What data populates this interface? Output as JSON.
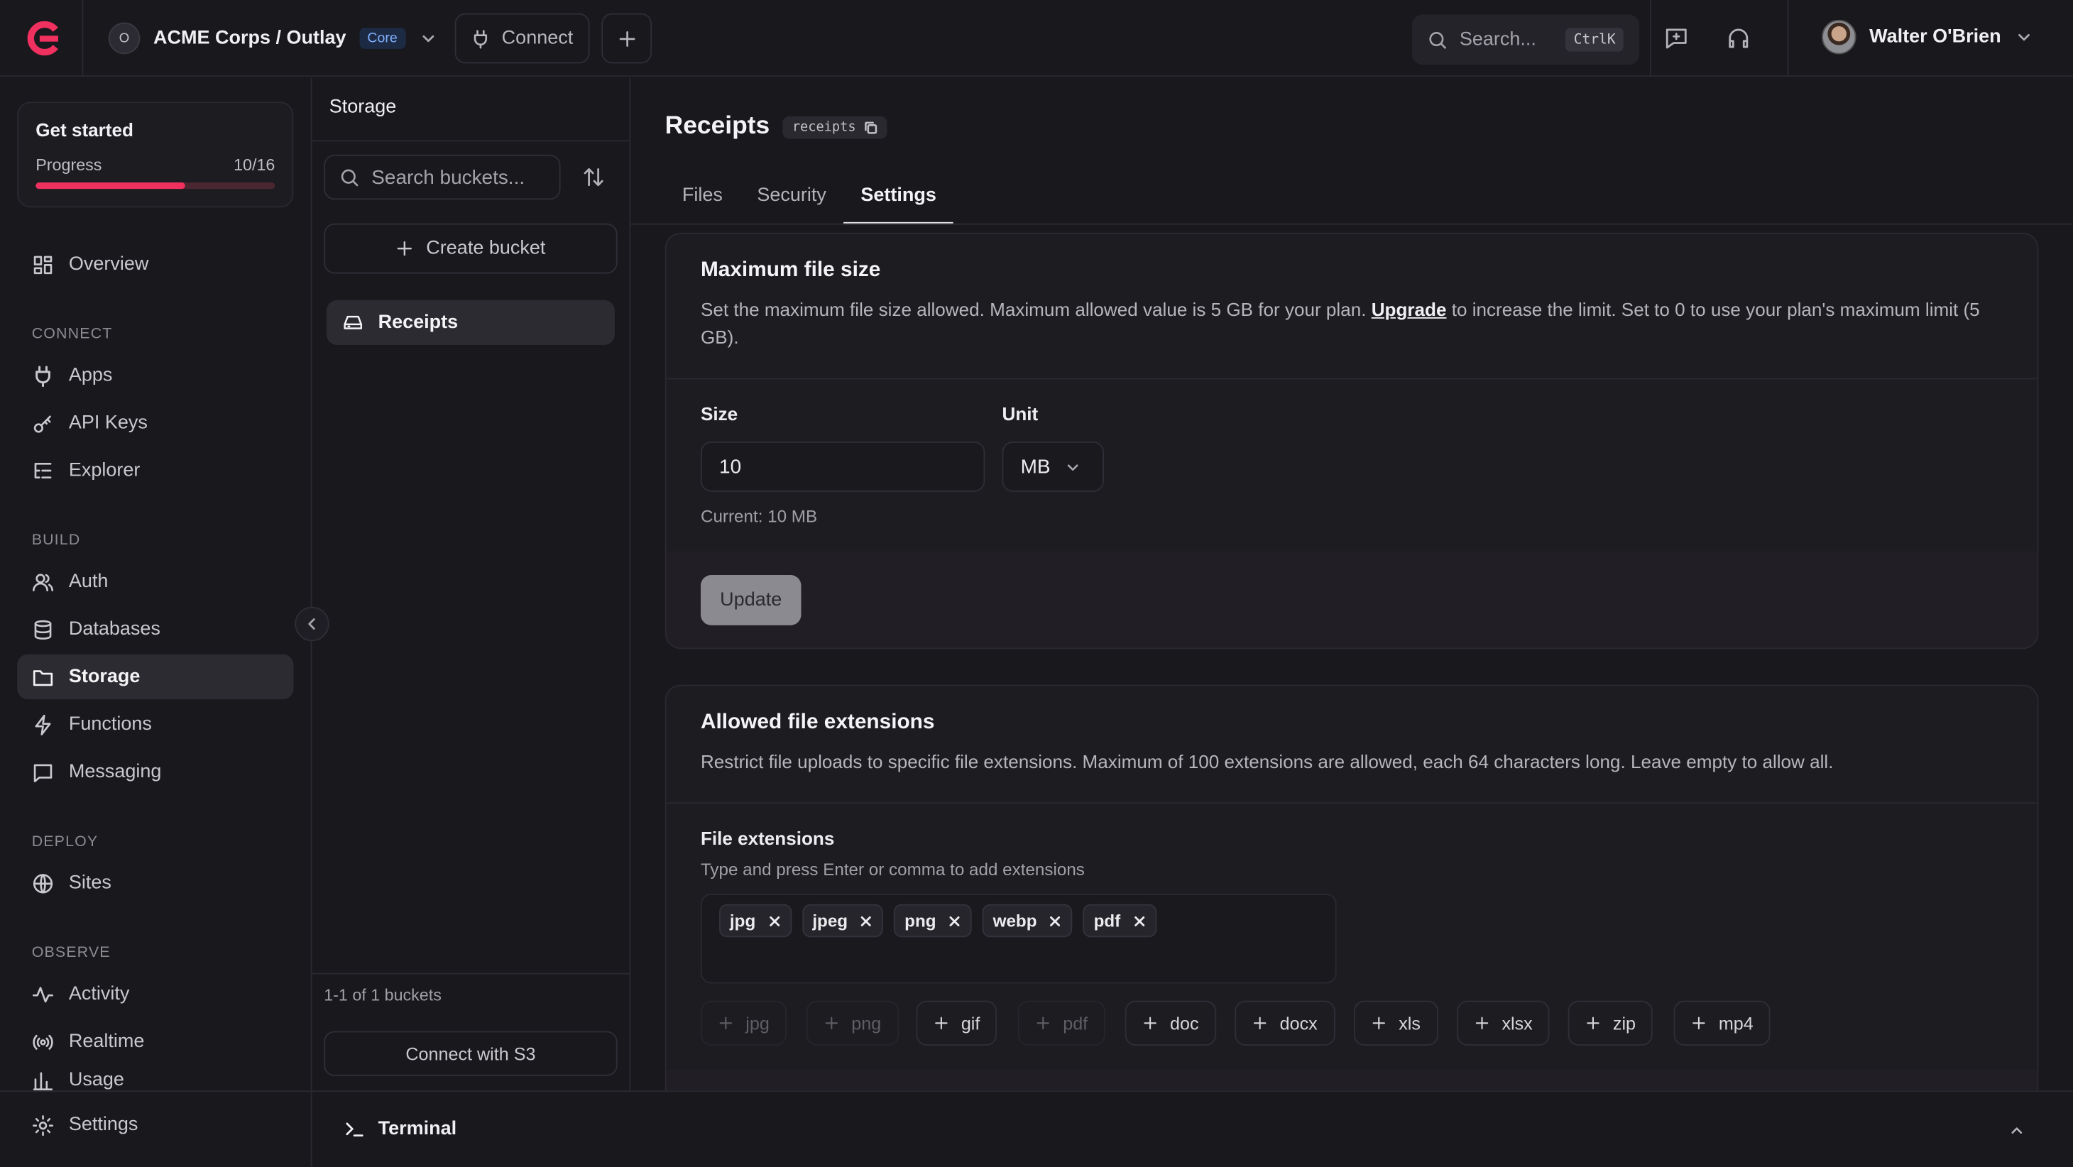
{
  "header": {
    "org_initial": "O",
    "org_name": "ACME Corps / Outlay",
    "plan_badge": "Core",
    "connect_label": "Connect",
    "search_placeholder": "Search...",
    "search_shortcut": "CtrlK",
    "user_name": "Walter O'Brien"
  },
  "colors": {
    "accent": "#f0305e",
    "background": "#19181d",
    "card": "#1d1c21"
  },
  "sidebar": {
    "get_started": {
      "title": "Get started",
      "progress_label": "Progress",
      "progress_text": "10/16",
      "progress_fraction": 0.625
    },
    "overview": "Overview",
    "sections": {
      "connect": "CONNECT",
      "build": "BUILD",
      "deploy": "DEPLOY",
      "observe": "OBSERVE"
    },
    "items": {
      "apps": "Apps",
      "api_keys": "API Keys",
      "explorer": "Explorer",
      "auth": "Auth",
      "databases": "Databases",
      "storage": "Storage",
      "functions": "Functions",
      "messaging": "Messaging",
      "sites": "Sites",
      "activity": "Activity",
      "realtime": "Realtime",
      "usage": "Usage",
      "settings": "Settings"
    }
  },
  "storage_panel": {
    "title": "Storage",
    "search_placeholder": "Search buckets...",
    "create_label": "Create bucket",
    "buckets": [
      "Receipts"
    ],
    "count_text": "1-1 of 1 buckets",
    "s3_label": "Connect with S3"
  },
  "terminal": {
    "label": "Terminal"
  },
  "main": {
    "title": "Receipts",
    "id_chip": "receipts",
    "tabs": [
      "Files",
      "Security",
      "Settings"
    ],
    "active_tab": "Settings",
    "max_size": {
      "heading": "Maximum file size",
      "desc_before": "Set the maximum file size allowed. Maximum allowed value is 5 GB for your plan. ",
      "desc_link": "Upgrade",
      "desc_after": " to increase the limit. Set to 0 to use your plan's maximum limit (5 GB).",
      "size_label": "Size",
      "size_value": "10",
      "unit_label": "Unit",
      "unit_value": "MB",
      "current_text": "Current: 10 MB",
      "update_label": "Update"
    },
    "extensions": {
      "heading": "Allowed file extensions",
      "desc": "Restrict file uploads to specific file extensions. Maximum of 100 extensions are allowed, each 64 characters long. Leave empty to allow all.",
      "field_label": "File extensions",
      "field_hint": "Type and press Enter or comma to add extensions",
      "tags": [
        "jpg",
        "jpeg",
        "png",
        "webp",
        "pdf"
      ],
      "suggestions": [
        {
          "label": "jpg",
          "disabled": true
        },
        {
          "label": "png",
          "disabled": true
        },
        {
          "label": "gif",
          "disabled": false
        },
        {
          "label": "pdf",
          "disabled": true
        },
        {
          "label": "doc",
          "disabled": false
        },
        {
          "label": "docx",
          "disabled": false
        },
        {
          "label": "xls",
          "disabled": false
        },
        {
          "label": "xlsx",
          "disabled": false
        },
        {
          "label": "zip",
          "disabled": false
        },
        {
          "label": "mp4",
          "disabled": false
        }
      ]
    }
  }
}
